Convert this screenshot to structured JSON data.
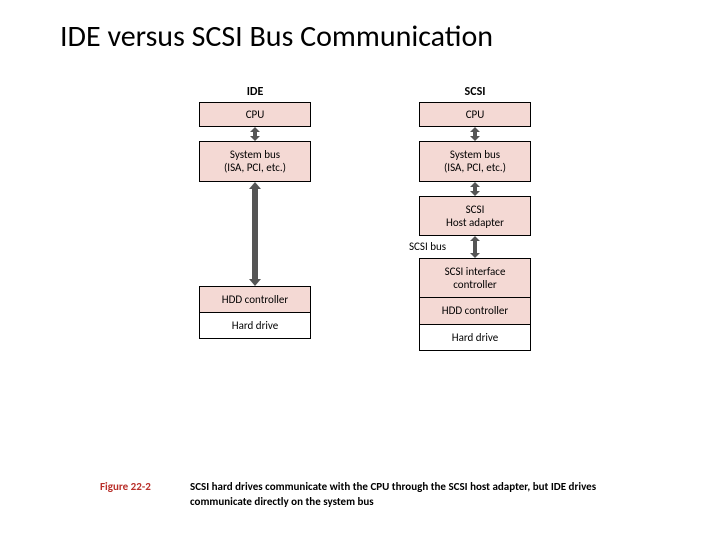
{
  "title": "IDE versus SCSI Bus Communication",
  "ide": {
    "header": "IDE",
    "cpu": "CPU",
    "sysbus_l1": "System bus",
    "sysbus_l2": "(ISA, PCI, etc.)",
    "hdd_ctrl": "HDD controller",
    "hard_drive": "Hard drive"
  },
  "scsi": {
    "header": "SCSI",
    "cpu": "CPU",
    "sysbus_l1": "System bus",
    "sysbus_l2": "(ISA, PCI, etc.)",
    "host_adapter_l1": "SCSI",
    "host_adapter_l2": "Host adapter",
    "bus_label": "SCSI bus",
    "iface_l1": "SCSI interface",
    "iface_l2": "controller",
    "hdd_ctrl": "HDD controller",
    "hard_drive": "Hard drive"
  },
  "caption": {
    "fig": "Figure 22-2",
    "text": "SCSI hard drives communicate with the CPU through the SCSI host adapter, but IDE drives communicate directly on the system bus"
  }
}
